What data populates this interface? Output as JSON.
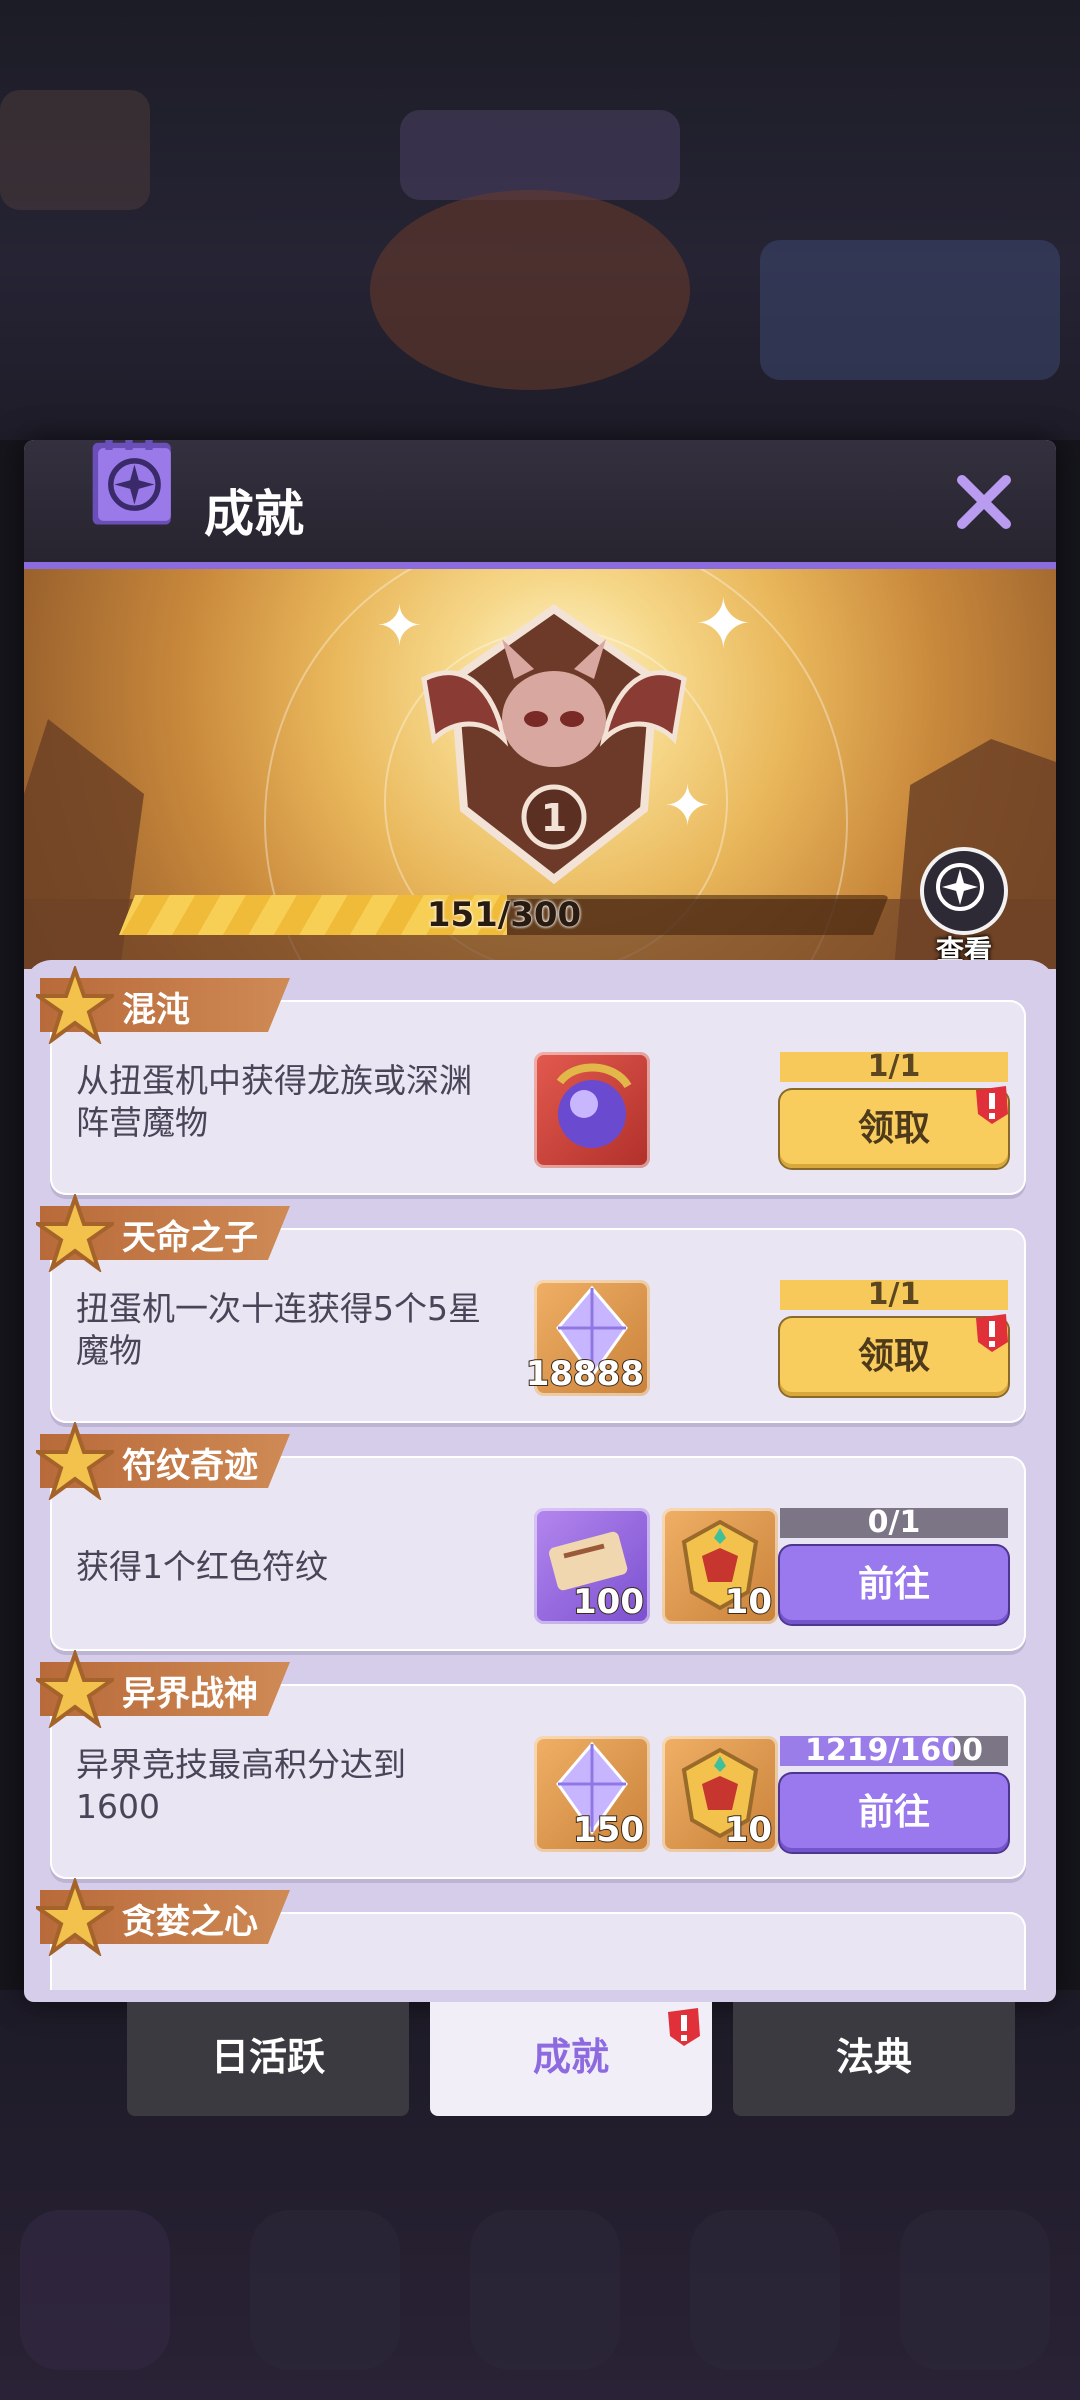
{
  "modal": {
    "title": "成就",
    "icon": "achievement-book-icon",
    "close_icon": "close-icon"
  },
  "banner": {
    "rank_level": "1",
    "progress_text": "151/300",
    "progress_value": 151,
    "progress_max": 300,
    "view_label": "查看"
  },
  "achievements": [
    {
      "name": "混沌",
      "desc": "从扭蛋机中获得龙族或深渊阵营魔物",
      "rewards": [
        {
          "icon": "crystal-orb-icon",
          "qty": ""
        }
      ],
      "count": "1/1",
      "action": "领取",
      "state": "claim",
      "alert": true
    },
    {
      "name": "天命之子",
      "desc": "扭蛋机一次十连获得5个5星魔物",
      "rewards": [
        {
          "icon": "diamond-gem-icon",
          "qty": "18888"
        }
      ],
      "count": "1/1",
      "action": "领取",
      "state": "claim",
      "alert": true
    },
    {
      "name": "符纹奇迹",
      "desc": "获得1个红色符纹",
      "rewards": [
        {
          "icon": "scroll-ticket-icon",
          "qty": "100"
        },
        {
          "icon": "golden-crest-icon",
          "qty": "10"
        }
      ],
      "count": "0/1",
      "action": "前往",
      "state": "go",
      "alert": false
    },
    {
      "name": "异界战神",
      "desc": "异界竞技最高积分达到1600",
      "rewards": [
        {
          "icon": "diamond-gem-icon",
          "qty": "150"
        },
        {
          "icon": "golden-crest-icon",
          "qty": "10"
        }
      ],
      "count": "1219/1600",
      "action": "前往",
      "state": "go",
      "alert": false
    },
    {
      "name": "贪婪之心"
    }
  ],
  "tabs": [
    {
      "label": "日活跃",
      "active": false
    },
    {
      "label": "成就",
      "active": true,
      "alert": true
    },
    {
      "label": "法典",
      "active": false
    }
  ],
  "colors": {
    "accent_purple": "#9a78ee",
    "claim_yellow": "#f8cd5e",
    "tag_orange": "#c07a48",
    "panel_bg": "#d6cdeb"
  }
}
